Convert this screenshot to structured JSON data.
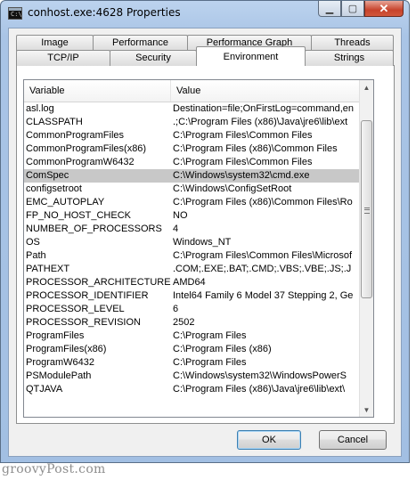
{
  "window": {
    "icon_text": "C:\\",
    "title": "conhost.exe:4628 Properties",
    "minimize": "▁",
    "maximize": "▢",
    "close": "✕"
  },
  "tabs": {
    "back_row": [
      "Image",
      "Performance",
      "Performance Graph",
      "Threads"
    ],
    "front_row": [
      "TCP/IP",
      "Security",
      "Environment",
      "Strings"
    ],
    "active": "Environment"
  },
  "list": {
    "headers": {
      "variable": "Variable",
      "value": "Value"
    },
    "selected_variable": "ComSpec",
    "rows": [
      {
        "variable": "asl.log",
        "value": "Destination=file;OnFirstLog=command,en"
      },
      {
        "variable": "CLASSPATH",
        "value": ".;C:\\Program Files (x86)\\Java\\jre6\\lib\\ext"
      },
      {
        "variable": "CommonProgramFiles",
        "value": "C:\\Program Files\\Common Files"
      },
      {
        "variable": "CommonProgramFiles(x86)",
        "value": "C:\\Program Files (x86)\\Common Files"
      },
      {
        "variable": "CommonProgramW6432",
        "value": "C:\\Program Files\\Common Files"
      },
      {
        "variable": "ComSpec",
        "value": "C:\\Windows\\system32\\cmd.exe"
      },
      {
        "variable": "configsetroot",
        "value": "C:\\Windows\\ConfigSetRoot"
      },
      {
        "variable": "EMC_AUTOPLAY",
        "value": "C:\\Program Files (x86)\\Common Files\\Ro"
      },
      {
        "variable": "FP_NO_HOST_CHECK",
        "value": "NO"
      },
      {
        "variable": "NUMBER_OF_PROCESSORS",
        "value": "4"
      },
      {
        "variable": "OS",
        "value": "Windows_NT"
      },
      {
        "variable": "Path",
        "value": "C:\\Program Files\\Common Files\\Microsof"
      },
      {
        "variable": "PATHEXT",
        "value": ".COM;.EXE;.BAT;.CMD;.VBS;.VBE;.JS;.J"
      },
      {
        "variable": "PROCESSOR_ARCHITECTURE",
        "value": "AMD64"
      },
      {
        "variable": "PROCESSOR_IDENTIFIER",
        "value": "Intel64 Family 6 Model 37 Stepping 2, Ge"
      },
      {
        "variable": "PROCESSOR_LEVEL",
        "value": "6"
      },
      {
        "variable": "PROCESSOR_REVISION",
        "value": "2502"
      },
      {
        "variable": "ProgramFiles",
        "value": "C:\\Program Files"
      },
      {
        "variable": "ProgramFiles(x86)",
        "value": "C:\\Program Files (x86)"
      },
      {
        "variable": "ProgramW6432",
        "value": "C:\\Program Files"
      },
      {
        "variable": "PSModulePath",
        "value": "C:\\Windows\\system32\\WindowsPowerS"
      },
      {
        "variable": "QTJAVA",
        "value": "C:\\Program Files (x86)\\Java\\jre6\\lib\\ext\\"
      }
    ],
    "scroll_position": 0.2
  },
  "buttons": {
    "ok": "OK",
    "cancel": "Cancel"
  },
  "watermark": "groovyPost.com"
}
